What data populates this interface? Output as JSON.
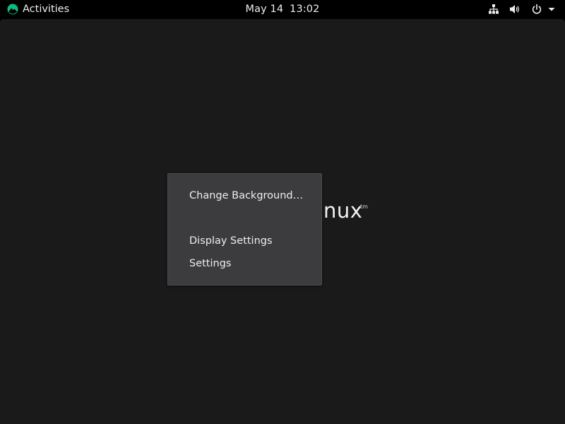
{
  "topbar": {
    "activities_label": "Activities",
    "date": "May 14",
    "time": "13:02",
    "logo_icon": "rocky-linux-logo-icon",
    "logo_color": "#10b981",
    "tray_icons": [
      "network-wired-icon",
      "volume-icon",
      "power-icon",
      "chevron-down-icon"
    ]
  },
  "desktop": {
    "wordmark_visible": "nux",
    "trademark": "tm",
    "background_color": "#1a1a1b"
  },
  "context_menu": {
    "items": [
      {
        "label": "Change Background…"
      },
      {
        "label": "Display Settings"
      },
      {
        "label": "Settings"
      }
    ],
    "background_color": "#3c3c3e"
  }
}
